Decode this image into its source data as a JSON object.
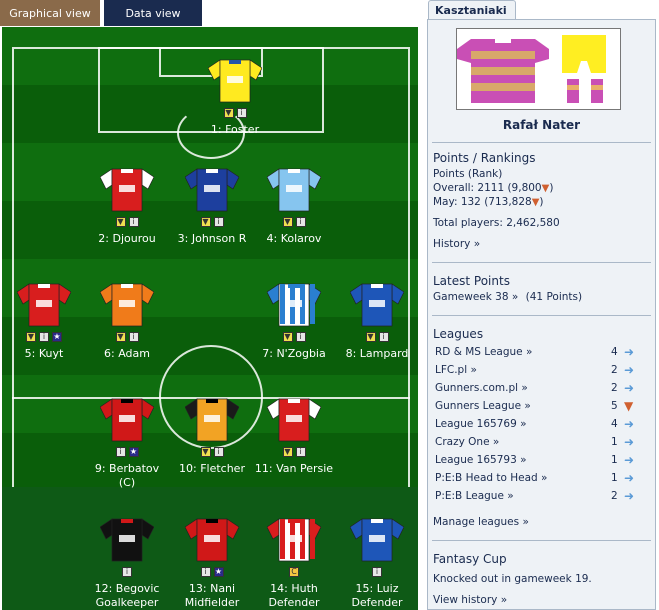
{
  "tabs": {
    "graphical": "Graphical view",
    "data": "Data view"
  },
  "players": [
    {
      "id": "p1",
      "name": "1: Foster",
      "kit": "yellow",
      "icons": [
        "flag",
        "info"
      ]
    },
    {
      "id": "p2",
      "name": "2: Djourou",
      "kit": "red-white",
      "icons": [
        "flag",
        "info"
      ]
    },
    {
      "id": "p3",
      "name": "3: Johnson R",
      "kit": "blue-white",
      "icons": [
        "flag",
        "info"
      ]
    },
    {
      "id": "p4",
      "name": "4: Kolarov",
      "kit": "skyblue",
      "icons": [
        "flag",
        "info"
      ]
    },
    {
      "id": "p5",
      "name": "5: Kuyt",
      "kit": "red",
      "icons": [
        "flag",
        "info",
        "star"
      ]
    },
    {
      "id": "p6",
      "name": "6: Adam",
      "kit": "orange",
      "icons": [
        "flag",
        "info"
      ]
    },
    {
      "id": "p7",
      "name": "7: N'Zogbia",
      "kit": "blue-stripes",
      "icons": [
        "flag",
        "info"
      ]
    },
    {
      "id": "p8",
      "name": "8: Lampard",
      "kit": "chelsea",
      "icons": [
        "flag",
        "info"
      ]
    },
    {
      "id": "p9",
      "name": "9: Berbatov",
      "name2": "(C)",
      "kit": "manutd",
      "icons": [
        "info",
        "star"
      ]
    },
    {
      "id": "p10",
      "name": "10: Fletcher",
      "kit": "wolves",
      "icons": [
        "flag",
        "info"
      ]
    },
    {
      "id": "p11",
      "name": "11: Van Persie",
      "kit": "red-white",
      "icons": [
        "flag",
        "info"
      ]
    },
    {
      "id": "b12",
      "name": "12: Begovic",
      "name2": "Goalkeeper",
      "kit": "black",
      "icons": [
        "info"
      ]
    },
    {
      "id": "b13",
      "name": "13: Nani",
      "name2": "Midfielder",
      "kit": "manutd",
      "icons": [
        "info",
        "star"
      ]
    },
    {
      "id": "b14",
      "name": "14: Huth",
      "name2": "Defender",
      "kit": "stoke",
      "icons": [
        "cap"
      ]
    },
    {
      "id": "b15",
      "name": "15: Luiz",
      "name2": "Defender",
      "kit": "chelsea",
      "icons": [
        "info"
      ]
    }
  ],
  "colors": {
    "pitch_dark": "#0a5e0a",
    "pitch_light": "#0f6e0f",
    "navy": "#1a2b4f",
    "arrow_up": "#5a9ad6",
    "arrow_down": "#d06030"
  },
  "sidebar": {
    "tab_label": "Kasztaniaki",
    "manager": "Rafał Nater",
    "points_title": "Points / Rankings",
    "points_rank_label": "Points (Rank)",
    "overall_text": "Overall: 2111 (9,800",
    "may_text": "May: 132 (713,828",
    "close_paren": ")",
    "total_players": "Total players: 2,462,580",
    "history_link": "History »",
    "latest_title": "Latest Points",
    "gameweek_link": "Gameweek 38 »",
    "gameweek_points": "(41 Points)",
    "leagues_title": "Leagues",
    "leagues": [
      {
        "name": "RD & MS League »",
        "rank": "4",
        "trend": "up"
      },
      {
        "name": "LFC.pl »",
        "rank": "2",
        "trend": "up"
      },
      {
        "name": "Gunners.com.pl »",
        "rank": "2",
        "trend": "up"
      },
      {
        "name": "Gunners League »",
        "rank": "5",
        "trend": "down"
      },
      {
        "name": "League 165769 »",
        "rank": "4",
        "trend": "up"
      },
      {
        "name": "Crazy One »",
        "rank": "1",
        "trend": "up"
      },
      {
        "name": "League 165793 »",
        "rank": "1",
        "trend": "up"
      },
      {
        "name": "P:E:B Head to Head »",
        "rank": "1",
        "trend": "up"
      },
      {
        "name": "P:E:B League »",
        "rank": "2",
        "trend": "up"
      }
    ],
    "manage_leagues": "Manage leagues »",
    "cup_title": "Fantasy Cup",
    "cup_text": "Knocked out in gameweek 19.",
    "view_history": "View history »"
  }
}
